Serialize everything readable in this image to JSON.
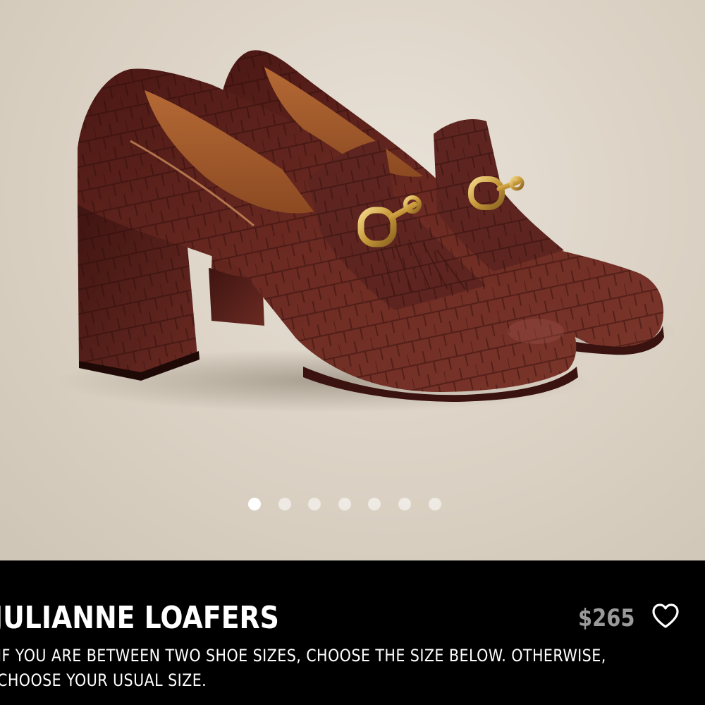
{
  "product": {
    "title": "JULIANNE LOAFERS",
    "price": "$265",
    "size_note": "IF YOU ARE BETWEEN TWO SHOE SIZES, CHOOSE THE SIZE BELOW. OTHERWISE, CHOOSE YOUR USUAL SIZE.",
    "favorite_icon": "heart-outline-icon",
    "image": {
      "subject": "brown croc-embossed heeled loafers with gold horsebit",
      "background_color": "#ddd4c7",
      "leather_color": "#5a1f1a"
    }
  },
  "carousel": {
    "total_slides": 7,
    "active_index": 0
  },
  "colors": {
    "panel_bg": "#000000",
    "title_text": "#ffffff",
    "price_text": "#9a9a9a"
  }
}
